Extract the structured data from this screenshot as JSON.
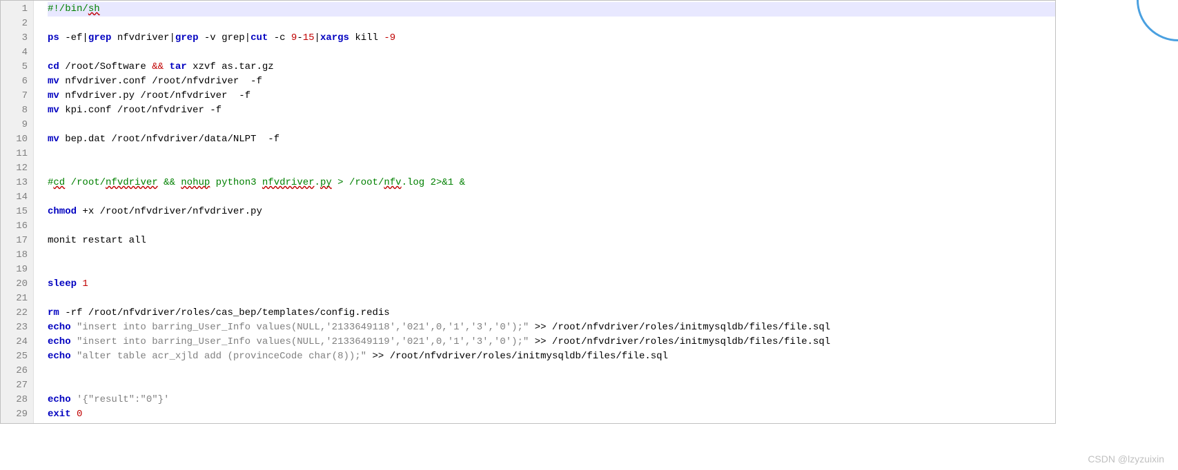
{
  "watermark": "CSDN @lzyzuixin",
  "lines": [
    {
      "n": 1,
      "hl": true,
      "tokens": [
        {
          "t": "#!/bin/",
          "c": "c-green"
        },
        {
          "t": "sh",
          "c": "c-green squiggle"
        }
      ]
    },
    {
      "n": 2,
      "tokens": []
    },
    {
      "n": 3,
      "tokens": [
        {
          "t": "ps",
          "c": "c-blue"
        },
        {
          "t": " -ef|",
          "c": "c-black"
        },
        {
          "t": "grep",
          "c": "c-blue"
        },
        {
          "t": " nfvdriver|",
          "c": "c-black"
        },
        {
          "t": "grep",
          "c": "c-blue"
        },
        {
          "t": " -v grep|",
          "c": "c-black"
        },
        {
          "t": "cut",
          "c": "c-blue"
        },
        {
          "t": " -c ",
          "c": "c-black"
        },
        {
          "t": "9",
          "c": "c-red"
        },
        {
          "t": "-",
          "c": "c-black"
        },
        {
          "t": "15",
          "c": "c-red"
        },
        {
          "t": "|",
          "c": "c-black"
        },
        {
          "t": "xargs",
          "c": "c-blue"
        },
        {
          "t": " kill ",
          "c": "c-black"
        },
        {
          "t": "-9",
          "c": "c-red"
        }
      ]
    },
    {
      "n": 4,
      "tokens": []
    },
    {
      "n": 5,
      "tokens": [
        {
          "t": "cd",
          "c": "c-blue"
        },
        {
          "t": " /root/Software ",
          "c": "c-black"
        },
        {
          "t": "&&",
          "c": "c-red"
        },
        {
          "t": " ",
          "c": "c-black"
        },
        {
          "t": "tar",
          "c": "c-blue"
        },
        {
          "t": " xzvf as.tar.gz",
          "c": "c-black"
        }
      ]
    },
    {
      "n": 6,
      "tokens": [
        {
          "t": "mv",
          "c": "c-blue"
        },
        {
          "t": " nfvdriver.conf /root/nfvdriver  -f",
          "c": "c-black"
        }
      ]
    },
    {
      "n": 7,
      "tokens": [
        {
          "t": "mv",
          "c": "c-blue"
        },
        {
          "t": " nfvdriver.py /root/nfvdriver  -f",
          "c": "c-black"
        }
      ]
    },
    {
      "n": 8,
      "tokens": [
        {
          "t": "mv",
          "c": "c-blue"
        },
        {
          "t": " kpi.conf /root/nfvdriver -f",
          "c": "c-black"
        }
      ]
    },
    {
      "n": 9,
      "tokens": []
    },
    {
      "n": 10,
      "tokens": [
        {
          "t": "mv",
          "c": "c-blue"
        },
        {
          "t": " bep.dat /root/nfvdriver/data/NLPT  -f",
          "c": "c-black"
        }
      ]
    },
    {
      "n": 11,
      "tokens": []
    },
    {
      "n": 12,
      "tokens": []
    },
    {
      "n": 13,
      "tokens": [
        {
          "t": "#",
          "c": "c-green"
        },
        {
          "t": "cd",
          "c": "c-green squiggle"
        },
        {
          "t": " /root/",
          "c": "c-green"
        },
        {
          "t": "nfvdriver",
          "c": "c-green squiggle"
        },
        {
          "t": " && ",
          "c": "c-green"
        },
        {
          "t": "nohup",
          "c": "c-green squiggle"
        },
        {
          "t": " python3 ",
          "c": "c-green"
        },
        {
          "t": "nfvdriver",
          "c": "c-green squiggle"
        },
        {
          "t": ".",
          "c": "c-green"
        },
        {
          "t": "py",
          "c": "c-green squiggle"
        },
        {
          "t": " > /root/",
          "c": "c-green"
        },
        {
          "t": "nfv",
          "c": "c-green squiggle"
        },
        {
          "t": ".log 2>&1 &",
          "c": "c-green"
        }
      ]
    },
    {
      "n": 14,
      "tokens": []
    },
    {
      "n": 15,
      "tokens": [
        {
          "t": "chmod",
          "c": "c-blue"
        },
        {
          "t": " +x /root/nfvdriver/nfvdriver.py",
          "c": "c-black"
        }
      ]
    },
    {
      "n": 16,
      "tokens": []
    },
    {
      "n": 17,
      "tokens": [
        {
          "t": "monit restart all",
          "c": "c-black"
        }
      ]
    },
    {
      "n": 18,
      "tokens": []
    },
    {
      "n": 19,
      "tokens": []
    },
    {
      "n": 20,
      "tokens": [
        {
          "t": "sleep",
          "c": "c-blue"
        },
        {
          "t": " ",
          "c": "c-black"
        },
        {
          "t": "1",
          "c": "c-red"
        }
      ]
    },
    {
      "n": 21,
      "tokens": []
    },
    {
      "n": 22,
      "tokens": [
        {
          "t": "rm",
          "c": "c-blue"
        },
        {
          "t": " -rf /root/nfvdriver/roles/cas_bep/templates/config.redis",
          "c": "c-black"
        }
      ]
    },
    {
      "n": 23,
      "tokens": [
        {
          "t": "echo",
          "c": "c-blue"
        },
        {
          "t": " ",
          "c": "c-black"
        },
        {
          "t": "\"insert into barring_User_Info values(NULL,'2133649118','021',0,'1','3','0');\"",
          "c": "c-gray"
        },
        {
          "t": " >> /root/nfvdriver/roles/initmysqldb/files/file.sql",
          "c": "c-black"
        }
      ]
    },
    {
      "n": 24,
      "tokens": [
        {
          "t": "echo",
          "c": "c-blue"
        },
        {
          "t": " ",
          "c": "c-black"
        },
        {
          "t": "\"insert into barring_User_Info values(NULL,'2133649119','021',0,'1','3','0');\"",
          "c": "c-gray"
        },
        {
          "t": " >> /root/nfvdriver/roles/initmysqldb/files/file.sql",
          "c": "c-black"
        }
      ]
    },
    {
      "n": 25,
      "tokens": [
        {
          "t": "echo",
          "c": "c-blue"
        },
        {
          "t": " ",
          "c": "c-black"
        },
        {
          "t": "\"alter table acr_xjld add (provinceCode char(8));\"",
          "c": "c-gray"
        },
        {
          "t": " >> /root/nfvdriver/roles/initmysqldb/files/file.sql",
          "c": "c-black"
        }
      ]
    },
    {
      "n": 26,
      "tokens": []
    },
    {
      "n": 27,
      "tokens": []
    },
    {
      "n": 28,
      "tokens": [
        {
          "t": "echo",
          "c": "c-blue"
        },
        {
          "t": " ",
          "c": "c-black"
        },
        {
          "t": "'{\"result\":\"0\"}'",
          "c": "c-gray"
        }
      ]
    },
    {
      "n": 29,
      "tokens": [
        {
          "t": "exit",
          "c": "c-blue"
        },
        {
          "t": " ",
          "c": "c-black"
        },
        {
          "t": "0",
          "c": "c-red"
        }
      ]
    }
  ]
}
